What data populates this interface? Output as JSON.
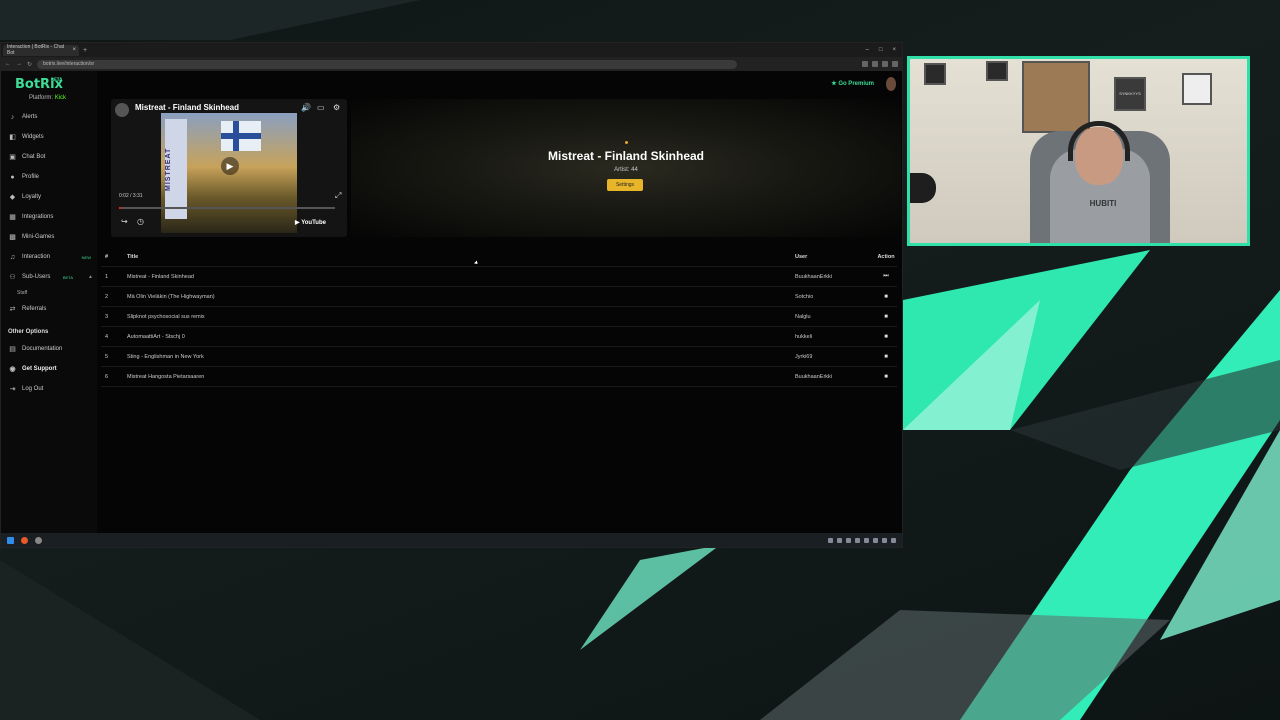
{
  "browser": {
    "tab_title": "Interaction | BotRix - Chat Bot",
    "url": "botrix.live/interaction/sr"
  },
  "sidebar": {
    "logo": "BotRix",
    "logo_badge": "BETA",
    "platform_label": "Platform:",
    "platform_value": "Kick",
    "items": [
      {
        "label": "Alerts",
        "icon": "bell-icon"
      },
      {
        "label": "Widgets",
        "icon": "layers-icon"
      },
      {
        "label": "Chat Bot",
        "icon": "chat-icon"
      },
      {
        "label": "Profile",
        "icon": "user-icon"
      },
      {
        "label": "Loyalty",
        "icon": "gem-icon"
      },
      {
        "label": "Integrations",
        "icon": "plug-icon"
      },
      {
        "label": "Mini-Games",
        "icon": "gamepad-icon"
      },
      {
        "label": "Interaction",
        "icon": "music-icon",
        "badge": "NEW"
      },
      {
        "label": "Sub-Users",
        "icon": "users-icon",
        "badge": "BETA"
      }
    ],
    "sub_item": "Staff",
    "referrals": "Referrals",
    "other_section": "Other Options",
    "other_items": [
      "Documentation",
      "Get Support",
      "Log Out"
    ]
  },
  "header": {
    "premium": "Go Premium"
  },
  "player": {
    "title": "Mistreat - Finland Skinhead",
    "time": "0:02 / 3:31",
    "brand": "YouTube",
    "art_text": "MISTREAT",
    "progress": 0.01
  },
  "now_playing": {
    "title": "Mistreat - Finland Skinhead",
    "artist": "Artist: 44",
    "button": "Settings"
  },
  "table": {
    "headers": {
      "num": "#",
      "title": "Title",
      "user": "User",
      "action": "Action"
    },
    "rows": [
      {
        "num": "1",
        "title": "Mistreat - Finland Skinhead",
        "user": "BuukhaanErkki",
        "action": "skip"
      },
      {
        "num": "2",
        "title": "Mä Olin Vieläkin (The Highwayman)",
        "user": "Sotchio",
        "action": "delete"
      },
      {
        "num": "3",
        "title": "Slipknot psychosocial sus remix",
        "user": "Nalglu",
        "action": "delete"
      },
      {
        "num": "4",
        "title": "AutomaattiArt - Stschj 0",
        "user": "hukkeli",
        "action": "delete"
      },
      {
        "num": "5",
        "title": "Sting - Englishman in New York",
        "user": "Jyrki69",
        "action": "delete"
      },
      {
        "num": "6",
        "title": "Mistreat Hangosta Pietarsaaren",
        "user": "BuukhaanErkki",
        "action": "delete"
      }
    ]
  },
  "webcam": {
    "shirt_text": "HUBITI",
    "poster_text": "SYNKKYYS"
  },
  "colors": {
    "accent": "#3ddc97",
    "kick_green": "#53fc18",
    "cam_border": "#2fe0a8",
    "settings_button": "#e8b52a"
  }
}
